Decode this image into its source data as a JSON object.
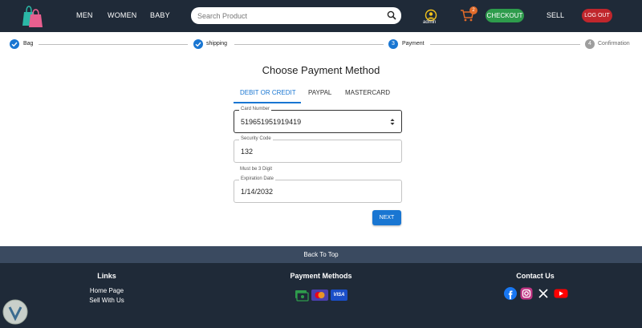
{
  "header": {
    "nav": [
      "MEN",
      "WOMEN",
      "BABY"
    ],
    "search_placeholder": "Search Product",
    "admin_label": "admin",
    "cart_count": "2",
    "checkout_label": "CHECKOUT",
    "sell_label": "SELL",
    "logout_label": "LOG OUT"
  },
  "stepper": {
    "steps": [
      {
        "label": "Bag",
        "state": "done"
      },
      {
        "label": "shipping",
        "state": "done"
      },
      {
        "label": "Payment",
        "number": "3",
        "state": "active"
      },
      {
        "label": "Confirmation",
        "number": "4",
        "state": "todo"
      }
    ]
  },
  "payment": {
    "title": "Choose Payment Method",
    "tabs": [
      "DEBIT OR CREDIT",
      "PAYPAL",
      "MASTERCARD"
    ],
    "active_tab": "DEBIT OR CREDIT",
    "card_number_label": "Card Number",
    "card_number_value": "519651951919419",
    "security_code_label": "Security Code",
    "security_code_value": "132",
    "security_helper": "Must be 3 Digit",
    "expiration_label": "Expiration Date",
    "expiration_value": "1/14/2032",
    "next_label": "NEXT"
  },
  "footer": {
    "back_to_top": "Back To Top",
    "links_heading": "Links",
    "links": [
      "Home Page",
      "Sell With Us"
    ],
    "payment_heading": "Payment Methods",
    "payment_icons": [
      "cash-icon",
      "mastercard-icon",
      "visa-icon"
    ],
    "visa_text": "VISA",
    "contact_heading": "Contact Us",
    "social_icons": [
      "facebook-icon",
      "instagram-icon",
      "x-icon",
      "youtube-icon"
    ]
  },
  "colors": {
    "header_bg": "#1f2a38",
    "accent": "#1976d2",
    "checkout": "#2e9c4c",
    "logout": "#c0262c",
    "back_top_bg": "#3a4a60"
  }
}
